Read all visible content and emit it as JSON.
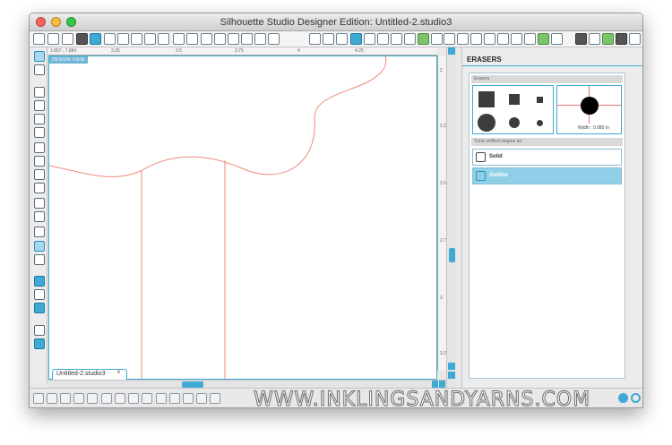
{
  "window": {
    "title": "Silhouette Studio Designer Edition: Untitled-2.studio3"
  },
  "ruler": {
    "coords": "1.857 , 7.884",
    "top_ticks": [
      "3.25",
      "3.5",
      "3.75",
      "4",
      "4.25"
    ],
    "right_ticks": [
      "2",
      "2.25",
      "2.5",
      "2.75",
      "3",
      "3.25"
    ]
  },
  "canvas": {
    "design_view": "DESIGN VIEW",
    "cut_line_color": "#f08a7e"
  },
  "document": {
    "tab_label": "Untitled-2.studio3",
    "close_mark": "x"
  },
  "panel": {
    "title": "ERASERS",
    "section_erasers": "Erasers",
    "width_label": "Width : 0.080 in",
    "section_unfilled": "Treat unfilled shapes as:",
    "options": [
      {
        "label": "Solid",
        "selected": false
      },
      {
        "label": "Outline",
        "selected": true
      }
    ]
  },
  "watermark": "WWW.INKLINGSANDYARNS.COM",
  "colors": {
    "accent": "#3fa9d4",
    "selected_option": "#8fd0e8",
    "crosshair": "#e57373"
  },
  "icons": {
    "toolbar": [
      "new-icon",
      "open-icon",
      "import-icon",
      "save-icon",
      "save-to-library-icon",
      "print-icon",
      "print-cut-icon",
      "copy-icon",
      "paste-icon",
      "cut-icon",
      "undo-icon",
      "redo-icon",
      "pan-icon",
      "zoom-in-icon",
      "zoom-out-icon",
      "zoom-select-icon",
      "fit-icon",
      "zoom-page-icon"
    ]
  }
}
